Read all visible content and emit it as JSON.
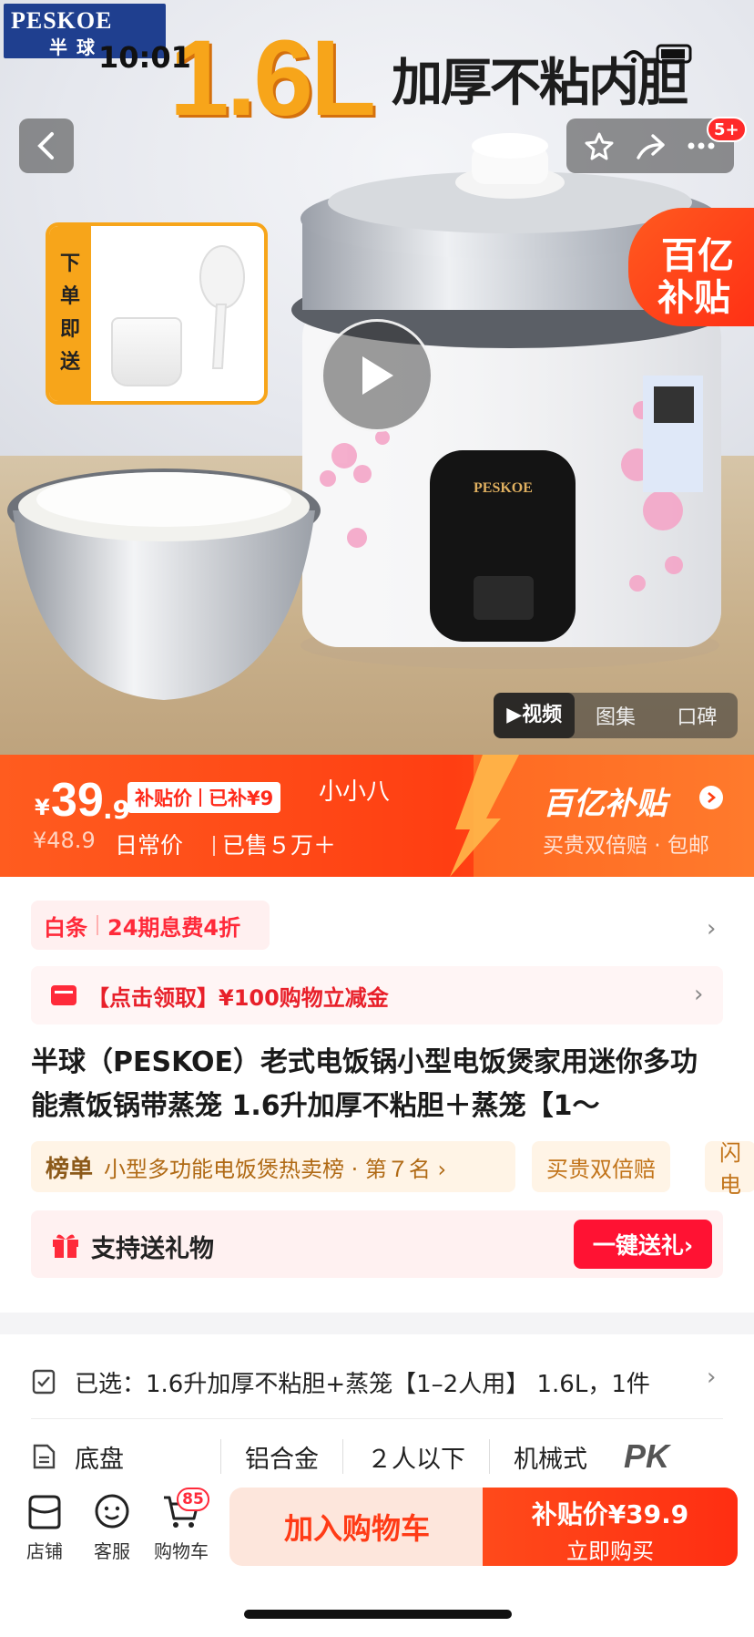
{
  "status": {
    "time": "10:01"
  },
  "hero": {
    "brand_en": "PESKOE",
    "brand_cn": "半球",
    "capacity": "1.6L",
    "tagline": "加厚不粘内胆",
    "gift_label": [
      "下",
      "单",
      "即",
      "送"
    ],
    "cart_badge_top": "5+",
    "subsidy_line1": "百亿",
    "subsidy_line2": "补贴",
    "media_tabs": [
      "▶视频",
      "图集",
      "口碑"
    ],
    "accent_orange": "#f7a51a"
  },
  "price": {
    "currency": "¥",
    "int": "39",
    "dec": ".9",
    "tag_a": "补贴价",
    "tag_b": "已补¥9",
    "user": "小小八",
    "original": "¥48.9",
    "daily": "日常价",
    "sold": "已售５万＋",
    "subsidy_title": "百亿补贴",
    "subsidy_desc": "买贵双倍赔 · 包邮",
    "color": "#ff3e12"
  },
  "baitiao": {
    "label": "白条",
    "offer": "24期息费4折"
  },
  "coupon": {
    "text": "【点击领取】¥100购物立减金"
  },
  "title": "半球（PESKOE）老式电饭锅小型电饭煲家用迷你多功能煮饭锅带蒸笼 1.6升加厚不粘胆＋蒸笼【1～",
  "rank": {
    "label": "榜单",
    "text": "小型多功能电饭煲热卖榜 · 第７名 ›"
  },
  "pills": [
    "买贵双倍赔",
    "闪电"
  ],
  "gift": {
    "text": "支持送礼物",
    "button": "一键送礼›"
  },
  "selected": {
    "text": "已选：1.6升加厚不粘胆+蒸笼【1–2人用】 1.6L，1件"
  },
  "specs": {
    "label": "底盘",
    "values": [
      "铝合金",
      "２人以下",
      "机械式"
    ],
    "pk": "PK"
  },
  "bottom": {
    "shop": "店铺",
    "service": "客服",
    "cart": "购物车",
    "cart_count": "85",
    "add_cart": "加入购物车",
    "buy_price": "补贴价¥39.9",
    "buy_now": "立即购买"
  }
}
